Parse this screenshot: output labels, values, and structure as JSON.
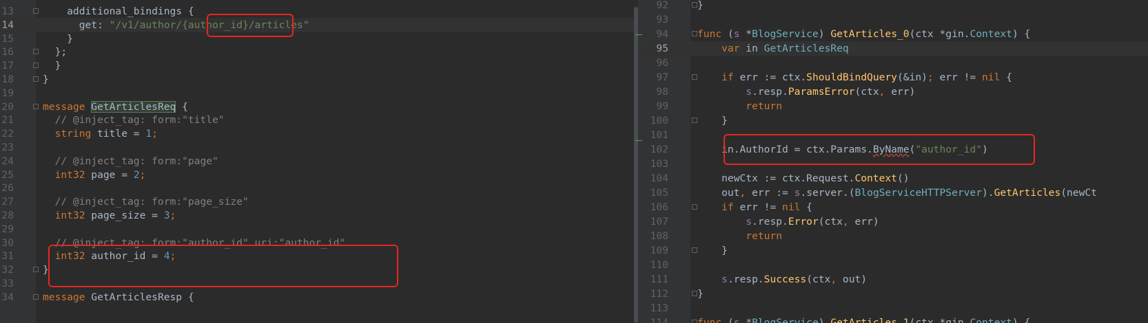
{
  "left_editor": {
    "lines": [
      {
        "n": "13",
        "fold": true,
        "segs": [
          {
            "t": "    additional_bindings {",
            "c": "plain"
          }
        ]
      },
      {
        "n": "14",
        "current": true,
        "segs": [
          {
            "t": "      get: ",
            "c": "plain"
          },
          {
            "t": "\"/v1/author/{author_id}/articles\"",
            "c": "str"
          }
        ]
      },
      {
        "n": "15",
        "segs": [
          {
            "t": "    }",
            "c": "plain"
          }
        ]
      },
      {
        "n": "16",
        "fold": true,
        "segs": [
          {
            "t": "  };",
            "c": "plain"
          }
        ]
      },
      {
        "n": "17",
        "fold": true,
        "segs": [
          {
            "t": "  }",
            "c": "plain"
          }
        ]
      },
      {
        "n": "18",
        "fold": true,
        "segs": [
          {
            "t": "}",
            "c": "plain"
          }
        ]
      },
      {
        "n": "19",
        "segs": []
      },
      {
        "n": "20",
        "fold": true,
        "segs": [
          {
            "t": "message ",
            "c": "kw"
          },
          {
            "t": "GetArticlesReq",
            "c": "hl"
          },
          {
            "t": " {",
            "c": "plain"
          }
        ]
      },
      {
        "n": "21",
        "segs": [
          {
            "t": "  // @inject_tag: form:\"title\"",
            "c": "cmt"
          }
        ]
      },
      {
        "n": "22",
        "segs": [
          {
            "t": "  string ",
            "c": "kw"
          },
          {
            "t": "title = ",
            "c": "plain"
          },
          {
            "t": "1",
            "c": "num"
          },
          {
            "t": ";",
            "c": "kw"
          }
        ]
      },
      {
        "n": "23",
        "segs": []
      },
      {
        "n": "24",
        "segs": [
          {
            "t": "  // @inject_tag: form:\"page\"",
            "c": "cmt"
          }
        ]
      },
      {
        "n": "25",
        "segs": [
          {
            "t": "  int32 ",
            "c": "kw"
          },
          {
            "t": "page = ",
            "c": "plain"
          },
          {
            "t": "2",
            "c": "num"
          },
          {
            "t": ";",
            "c": "kw"
          }
        ]
      },
      {
        "n": "26",
        "segs": []
      },
      {
        "n": "27",
        "segs": [
          {
            "t": "  // @inject_tag: form:\"page_size\"",
            "c": "cmt"
          }
        ]
      },
      {
        "n": "28",
        "segs": [
          {
            "t": "  int32 ",
            "c": "kw"
          },
          {
            "t": "page_size = ",
            "c": "plain"
          },
          {
            "t": "3",
            "c": "num"
          },
          {
            "t": ";",
            "c": "kw"
          }
        ]
      },
      {
        "n": "29",
        "segs": []
      },
      {
        "n": "30",
        "segs": [
          {
            "t": "  // @inject_tag: form:\"author_id\" uri:\"author_id\"",
            "c": "cmt"
          }
        ]
      },
      {
        "n": "31",
        "segs": [
          {
            "t": "  int32 ",
            "c": "kw"
          },
          {
            "t": "author_id = ",
            "c": "plain"
          },
          {
            "t": "4",
            "c": "num"
          },
          {
            "t": ";",
            "c": "kw"
          }
        ]
      },
      {
        "n": "32",
        "fold": true,
        "segs": [
          {
            "t": "}",
            "c": "plain"
          }
        ]
      },
      {
        "n": "33",
        "segs": []
      },
      {
        "n": "34",
        "fold": true,
        "segs": [
          {
            "t": "message ",
            "c": "kw"
          },
          {
            "t": "GetArticlesResp {",
            "c": "plain"
          }
        ]
      }
    ]
  },
  "right_editor": {
    "lines": [
      {
        "n": "92",
        "fold": true,
        "segs": [
          {
            "t": "}",
            "c": "plain"
          }
        ]
      },
      {
        "n": "93",
        "segs": []
      },
      {
        "n": "94",
        "fold": true,
        "segs": [
          {
            "t": "func ",
            "c": "kw"
          },
          {
            "t": "(",
            "c": "plain"
          },
          {
            "t": "s",
            "c": "var"
          },
          {
            "t": " *",
            "c": "plain"
          },
          {
            "t": "BlogService",
            "c": "typ"
          },
          {
            "t": ") ",
            "c": "plain"
          },
          {
            "t": "GetArticles_0",
            "c": "fn"
          },
          {
            "t": "(ctx *",
            "c": "plain"
          },
          {
            "t": "gin",
            "c": "plain"
          },
          {
            "t": ".",
            "c": "plain"
          },
          {
            "t": "Context",
            "c": "typ"
          },
          {
            "t": ") {",
            "c": "plain"
          }
        ]
      },
      {
        "n": "95",
        "current": true,
        "segs": [
          {
            "t": "    var ",
            "c": "kw"
          },
          {
            "t": "in ",
            "c": "plain"
          },
          {
            "t": "GetArticlesReq",
            "c": "typ"
          }
        ]
      },
      {
        "n": "96",
        "segs": []
      },
      {
        "n": "97",
        "fold": true,
        "segs": [
          {
            "t": "    if ",
            "c": "kw"
          },
          {
            "t": "err := ctx.",
            "c": "plain"
          },
          {
            "t": "ShouldBindQuery",
            "c": "fn"
          },
          {
            "t": "(&in)",
            "c": "plain"
          },
          {
            "t": "; ",
            "c": "kw"
          },
          {
            "t": "err != ",
            "c": "plain"
          },
          {
            "t": "nil",
            "c": "kw"
          },
          {
            "t": " {",
            "c": "plain"
          }
        ]
      },
      {
        "n": "98",
        "segs": [
          {
            "t": "        ",
            "c": "plain"
          },
          {
            "t": "s",
            "c": "var"
          },
          {
            "t": ".resp.",
            "c": "plain"
          },
          {
            "t": "ParamsError",
            "c": "fn"
          },
          {
            "t": "(ctx",
            "c": "plain"
          },
          {
            "t": ", ",
            "c": "kw"
          },
          {
            "t": "err)",
            "c": "plain"
          }
        ]
      },
      {
        "n": "99",
        "segs": [
          {
            "t": "        return",
            "c": "kw"
          }
        ]
      },
      {
        "n": "100",
        "fold": true,
        "segs": [
          {
            "t": "    }",
            "c": "plain"
          }
        ]
      },
      {
        "n": "101",
        "segs": []
      },
      {
        "n": "102",
        "segs": [
          {
            "t": "    in.AuthorId = ctx.Params.",
            "c": "plain"
          },
          {
            "t": "ByName",
            "c": "under"
          },
          {
            "t": "(",
            "c": "plain"
          },
          {
            "t": "\"author_id\"",
            "c": "str"
          },
          {
            "t": ")",
            "c": "plain"
          }
        ]
      },
      {
        "n": "103",
        "segs": []
      },
      {
        "n": "104",
        "segs": [
          {
            "t": "    newCtx := ctx.Request.",
            "c": "plain"
          },
          {
            "t": "Context",
            "c": "fn"
          },
          {
            "t": "()",
            "c": "plain"
          }
        ]
      },
      {
        "n": "105",
        "segs": [
          {
            "t": "    out",
            "c": "plain"
          },
          {
            "t": ", ",
            "c": "kw"
          },
          {
            "t": "err := ",
            "c": "plain"
          },
          {
            "t": "s",
            "c": "var"
          },
          {
            "t": ".server.(",
            "c": "plain"
          },
          {
            "t": "BlogServiceHTTPServer",
            "c": "typ"
          },
          {
            "t": ").",
            "c": "plain"
          },
          {
            "t": "GetArticles",
            "c": "fn"
          },
          {
            "t": "(newCt",
            "c": "plain"
          }
        ]
      },
      {
        "n": "106",
        "fold": true,
        "segs": [
          {
            "t": "    if ",
            "c": "kw"
          },
          {
            "t": "err != ",
            "c": "plain"
          },
          {
            "t": "nil",
            "c": "kw"
          },
          {
            "t": " {",
            "c": "plain"
          }
        ]
      },
      {
        "n": "107",
        "segs": [
          {
            "t": "        ",
            "c": "plain"
          },
          {
            "t": "s",
            "c": "var"
          },
          {
            "t": ".resp.",
            "c": "plain"
          },
          {
            "t": "Error",
            "c": "fn"
          },
          {
            "t": "(ctx",
            "c": "plain"
          },
          {
            "t": ", ",
            "c": "kw"
          },
          {
            "t": "err)",
            "c": "plain"
          }
        ]
      },
      {
        "n": "108",
        "segs": [
          {
            "t": "        return",
            "c": "kw"
          }
        ]
      },
      {
        "n": "109",
        "fold": true,
        "segs": [
          {
            "t": "    }",
            "c": "plain"
          }
        ]
      },
      {
        "n": "110",
        "segs": []
      },
      {
        "n": "111",
        "segs": [
          {
            "t": "    ",
            "c": "plain"
          },
          {
            "t": "s",
            "c": "var"
          },
          {
            "t": ".resp.",
            "c": "plain"
          },
          {
            "t": "Success",
            "c": "fn"
          },
          {
            "t": "(ctx",
            "c": "plain"
          },
          {
            "t": ", ",
            "c": "kw"
          },
          {
            "t": "out)",
            "c": "plain"
          }
        ]
      },
      {
        "n": "112",
        "fold": true,
        "segs": [
          {
            "t": "}",
            "c": "plain"
          }
        ]
      },
      {
        "n": "113",
        "segs": []
      },
      {
        "n": "114",
        "fold": true,
        "segs": [
          {
            "t": "func ",
            "c": "kw"
          },
          {
            "t": "(",
            "c": "plain"
          },
          {
            "t": "s",
            "c": "var"
          },
          {
            "t": " *",
            "c": "plain"
          },
          {
            "t": "BlogService",
            "c": "typ"
          },
          {
            "t": ") ",
            "c": "plain"
          },
          {
            "t": "GetArticles_1",
            "c": "fn"
          },
          {
            "t": "(ctx *",
            "c": "plain"
          },
          {
            "t": "gin",
            "c": "plain"
          },
          {
            "t": ".",
            "c": "plain"
          },
          {
            "t": "Context",
            "c": "typ"
          },
          {
            "t": ") {",
            "c": "plain"
          }
        ]
      }
    ]
  },
  "colors": {
    "background": "#2b2b2b",
    "gutter": "#313335",
    "keyword": "#cc7832",
    "string": "#6a8759",
    "comment": "#808080",
    "number": "#6897bb",
    "function": "#ffc66d",
    "highlight_box": "#e8261f"
  }
}
